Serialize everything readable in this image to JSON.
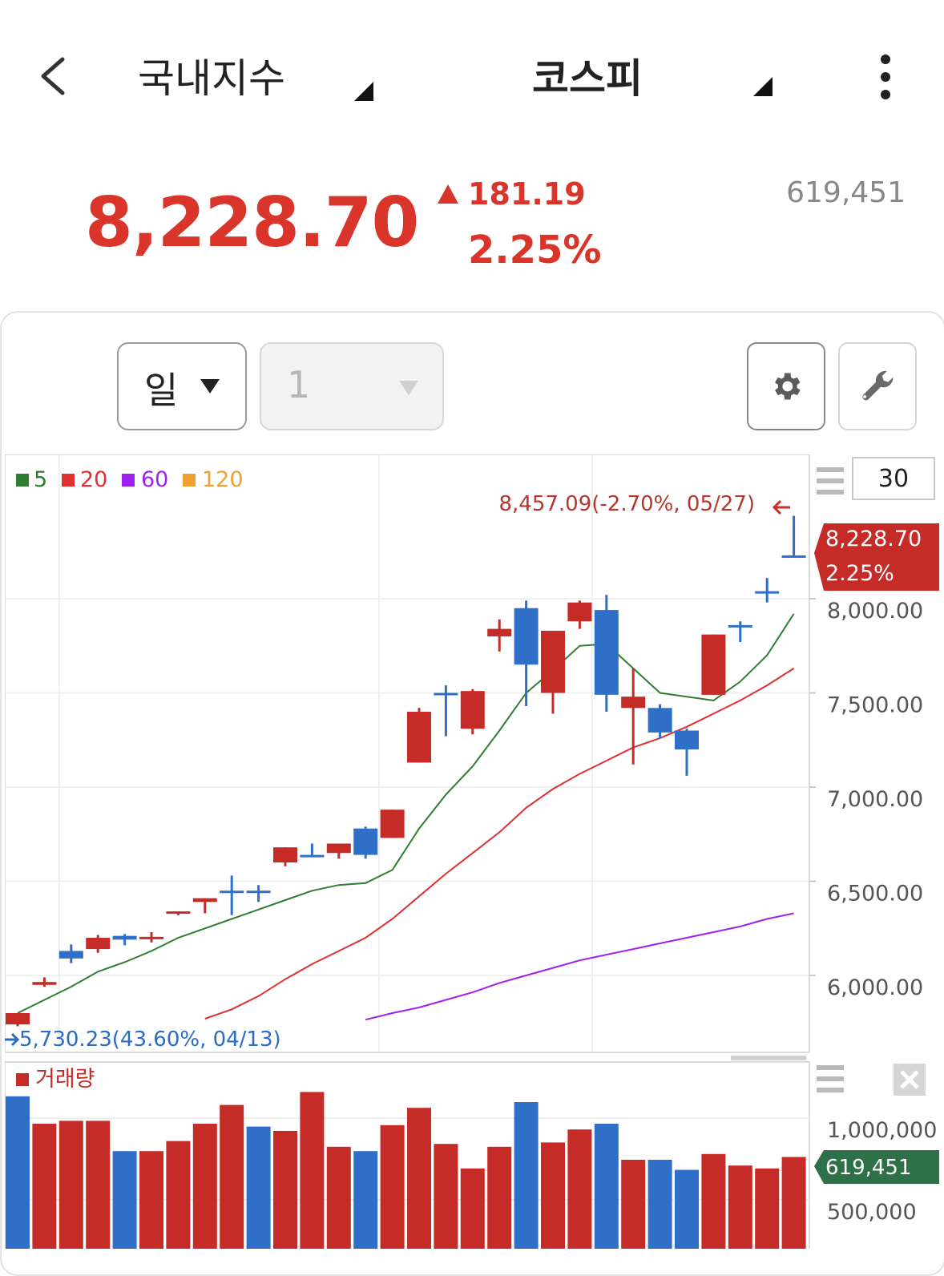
{
  "header": {
    "category": "국내지수",
    "index_name": "코스피"
  },
  "quote": {
    "price": "8,228.70",
    "change": "181.19",
    "change_pct": "2.25%",
    "volume": "619,451",
    "up_color": "#d9352b"
  },
  "controls": {
    "period": "일",
    "interval": "1"
  },
  "chart_data": {
    "type": "candlestick",
    "legend": [
      {
        "label": "5",
        "color": "#2e7d32"
      },
      {
        "label": "20",
        "color": "#e03030"
      },
      {
        "label": "60",
        "color": "#a020f0"
      },
      {
        "label": "120",
        "color": "#f0a030"
      }
    ],
    "candle_count": "30",
    "high_marker": "8,457.09(-2.70%, 05/27)",
    "low_marker": "5,730.23(43.60%, 04/13)",
    "last_label": {
      "price": "8,228.70",
      "pct": "2.25%"
    },
    "y_ticks": [
      "8,000.00",
      "7,500.00",
      "7,000.00",
      "6,500.00",
      "6,000.00"
    ],
    "y_tick_values": [
      8000,
      7500,
      7000,
      6500,
      6000
    ],
    "candles": [
      {
        "o": 5740,
        "h": 5800,
        "l": 5730,
        "c": 5800,
        "up": true
      },
      {
        "o": 5950,
        "h": 5990,
        "l": 5940,
        "c": 5965,
        "up": true
      },
      {
        "o": 6130,
        "h": 6165,
        "l": 6065,
        "c": 6090,
        "up": false
      },
      {
        "o": 6200,
        "h": 6215,
        "l": 6120,
        "c": 6140,
        "up": true
      },
      {
        "o": 6210,
        "h": 6220,
        "l": 6160,
        "c": 6190,
        "up": false
      },
      {
        "o": 6200,
        "h": 6230,
        "l": 6175,
        "c": 6205,
        "up": true
      },
      {
        "o": 6330,
        "h": 6340,
        "l": 6320,
        "c": 6340,
        "up": true
      },
      {
        "o": 6390,
        "h": 6400,
        "l": 6330,
        "c": 6410,
        "up": true
      },
      {
        "o": 6450,
        "h": 6530,
        "l": 6320,
        "c": 6450,
        "up": false
      },
      {
        "o": 6450,
        "h": 6480,
        "l": 6390,
        "c": 6450,
        "up": false
      },
      {
        "o": 6600,
        "h": 6655,
        "l": 6580,
        "c": 6680,
        "up": true
      },
      {
        "o": 6640,
        "h": 6700,
        "l": 6630,
        "c": 6640,
        "up": false
      },
      {
        "o": 6650,
        "h": 6700,
        "l": 6620,
        "c": 6700,
        "up": true
      },
      {
        "o": 6780,
        "h": 6790,
        "l": 6620,
        "c": 6640,
        "up": false
      },
      {
        "o": 6730,
        "h": 6880,
        "l": 6760,
        "c": 6880,
        "up": true
      },
      {
        "o": 7130,
        "h": 7420,
        "l": 7130,
        "c": 7400,
        "up": true
      },
      {
        "o": 7500,
        "h": 7540,
        "l": 7270,
        "c": 7500,
        "up": false
      },
      {
        "o": 7310,
        "h": 7520,
        "l": 7280,
        "c": 7510,
        "up": true
      },
      {
        "o": 7800,
        "h": 7890,
        "l": 7720,
        "c": 7840,
        "up": true
      },
      {
        "o": 7950,
        "h": 7990,
        "l": 7430,
        "c": 7650,
        "up": false
      },
      {
        "o": 7830,
        "h": 7820,
        "l": 7390,
        "c": 7500,
        "up": true
      },
      {
        "o": 7880,
        "h": 7990,
        "l": 7840,
        "c": 7980,
        "up": true
      },
      {
        "o": 7940,
        "h": 8020,
        "l": 7400,
        "c": 7490,
        "up": false
      },
      {
        "o": 7480,
        "h": 7630,
        "l": 7120,
        "c": 7420,
        "up": true
      },
      {
        "o": 7420,
        "h": 7440,
        "l": 7260,
        "c": 7290,
        "up": false
      },
      {
        "o": 7300,
        "h": 7310,
        "l": 7060,
        "c": 7200,
        "up": false
      },
      {
        "o": 7490,
        "h": 7810,
        "l": 7490,
        "c": 7810,
        "up": true
      },
      {
        "o": 7860,
        "h": 7880,
        "l": 7770,
        "c": 7860,
        "up": false
      },
      {
        "o": 8040,
        "h": 8110,
        "l": 7980,
        "c": 8040,
        "up": false
      },
      {
        "o": 8230,
        "h": 8440,
        "l": 8220,
        "c": 8230,
        "up": false
      }
    ],
    "ma5": [
      5800,
      5870,
      5940,
      6020,
      6070,
      6130,
      6200,
      6250,
      6300,
      6350,
      6400,
      6450,
      6480,
      6490,
      6560,
      6780,
      6960,
      7110,
      7300,
      7500,
      7620,
      7750,
      7760,
      7630,
      7500,
      7480,
      7460,
      7560,
      7700,
      7920
    ],
    "ma20_start": 7,
    "ma20": [
      5770,
      5820,
      5890,
      5980,
      6060,
      6130,
      6200,
      6300,
      6420,
      6540,
      6650,
      6760,
      6890,
      6990,
      7070,
      7140,
      7210,
      7260,
      7320,
      7390,
      7460,
      7540,
      7630
    ],
    "ma60_start": 13,
    "ma60": [
      5765,
      5800,
      5830,
      5870,
      5910,
      5960,
      6000,
      6040,
      6080,
      6110,
      6140,
      6170,
      6200,
      6230,
      6260,
      6300,
      6330
    ],
    "volume_label": "거래량",
    "volume_ticks": [
      "1,000,000",
      "500,000"
    ],
    "volume_last": "619,451",
    "volume": [
      1040000,
      850000,
      870000,
      870000,
      660000,
      660000,
      730000,
      850000,
      980000,
      830000,
      800000,
      1070000,
      690000,
      660000,
      840000,
      960000,
      710000,
      540000,
      690000,
      1000000,
      720000,
      810000,
      850000,
      600000,
      600000,
      530000,
      640000,
      560000,
      540000,
      619451
    ],
    "volume_up": [
      false,
      true,
      true,
      true,
      false,
      true,
      true,
      true,
      true,
      false,
      true,
      true,
      true,
      false,
      true,
      true,
      true,
      true,
      true,
      false,
      true,
      true,
      false,
      true,
      false,
      false,
      true,
      true,
      true,
      true
    ]
  }
}
